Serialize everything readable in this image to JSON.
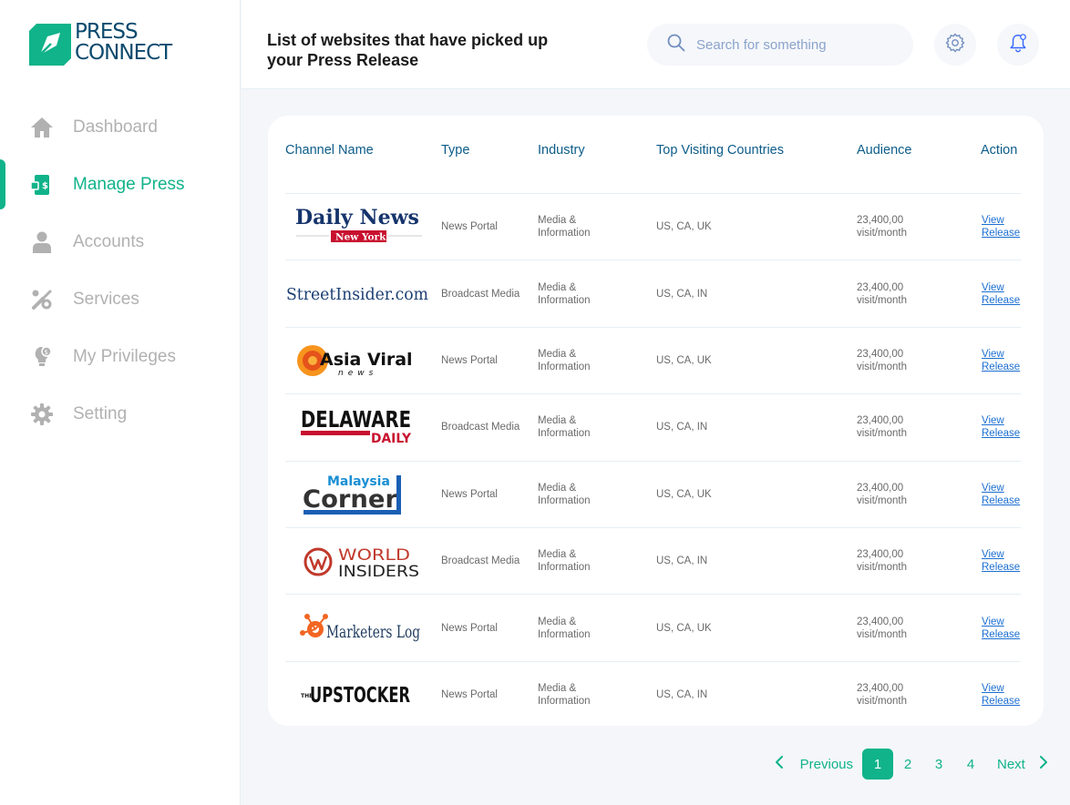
{
  "brand": {
    "name_line1": "PRESS",
    "name_line2": "CONNECT",
    "color": "#10b38a"
  },
  "sidebar": {
    "items": [
      {
        "label": "Dashboard",
        "icon": "home-icon",
        "active": false
      },
      {
        "label": "Manage Press",
        "icon": "press-release-icon",
        "active": true
      },
      {
        "label": "Accounts",
        "icon": "user-icon",
        "active": false
      },
      {
        "label": "Services",
        "icon": "tools-icon",
        "active": false
      },
      {
        "label": "My Privileges",
        "icon": "lightbulb-icon",
        "active": false
      },
      {
        "label": "Setting",
        "icon": "gear-icon",
        "active": false
      }
    ]
  },
  "header": {
    "title": "List of websites that have picked up your Press Release",
    "search_placeholder": "Search for something",
    "settings_icon": "gear-icon",
    "notifications_icon": "bell-icon"
  },
  "table": {
    "columns": [
      "Channel Name",
      "Type",
      "Industry",
      "Top Visiting Countries",
      "Audience",
      "Action"
    ],
    "rows": [
      {
        "logo_text": "Daily News",
        "logo_sub": "New York",
        "type": "News Portal",
        "industry": "Media & Information",
        "countries": "US, CA, UK",
        "audience": "23,400,00 visit/month",
        "action1": "View",
        "action2": "Release"
      },
      {
        "logo_text": "StreetInsider.com",
        "logo_sub": "",
        "type": "Broadcast Media",
        "industry": "Media & Information",
        "countries": "US, CA, IN",
        "audience": "23,400,00 visit/month",
        "action1": "View",
        "action2": "Release"
      },
      {
        "logo_text": "Asia Viral",
        "logo_sub": "news",
        "type": "News Portal",
        "industry": "Media & Information",
        "countries": "US, CA, UK",
        "audience": "23,400,00 visit/month",
        "action1": "View",
        "action2": "Release"
      },
      {
        "logo_text": "DELAWARE",
        "logo_sub": "DAILY",
        "type": "Broadcast Media",
        "industry": "Media & Information",
        "countries": "US, CA, IN",
        "audience": "23,400,00 visit/month",
        "action1": "View",
        "action2": "Release"
      },
      {
        "logo_text": "Corner",
        "logo_sub": "Malaysia",
        "type": "News Portal",
        "industry": "Media & Information",
        "countries": "US, CA, UK",
        "audience": "23,400,00 visit/month",
        "action1": "View",
        "action2": "Release"
      },
      {
        "logo_text": "WORLD",
        "logo_sub": "INSIDERS",
        "type": "Broadcast Media",
        "industry": "Media & Information",
        "countries": "US, CA, IN",
        "audience": "23,400,00 visit/month",
        "action1": "View",
        "action2": "Release"
      },
      {
        "logo_text": "Marketers Log",
        "logo_sub": "",
        "type": "News Portal",
        "industry": "Media & Information",
        "countries": "US, CA, UK",
        "audience": "23,400,00 visit/month",
        "action1": "View",
        "action2": "Release"
      },
      {
        "logo_text": "UPSTOCKER",
        "logo_sub": "THE",
        "type": "News Portal",
        "industry": "Media & Information",
        "countries": "US, CA, IN",
        "audience": "23,400,00 visit/month",
        "action1": "View",
        "action2": "Release"
      }
    ]
  },
  "pagination": {
    "previous": "Previous",
    "next": "Next",
    "pages": [
      "1",
      "2",
      "3",
      "4"
    ],
    "current": "1"
  }
}
